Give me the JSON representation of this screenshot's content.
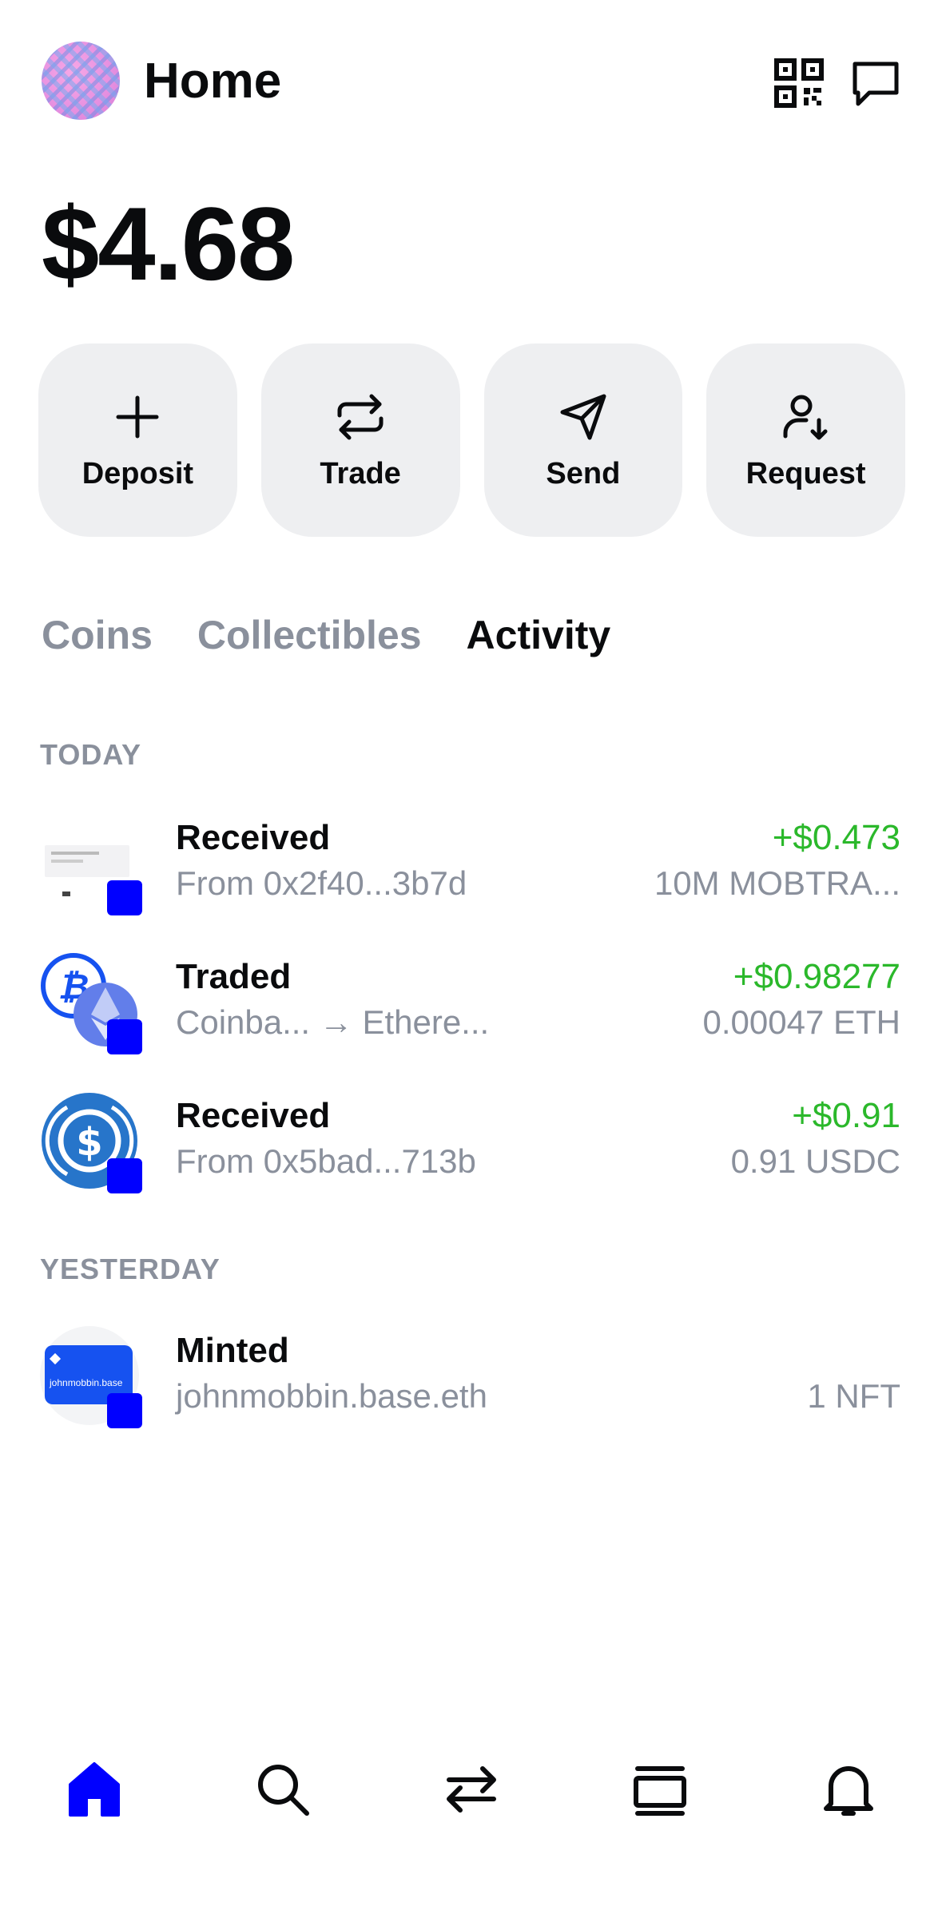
{
  "header": {
    "title": "Home",
    "qr_icon": "qr-code-icon",
    "chat_icon": "chat-bubble-icon"
  },
  "balance": "$4.68",
  "actions": [
    {
      "label": "Deposit",
      "icon": "plus-icon"
    },
    {
      "label": "Trade",
      "icon": "swap-arrows-icon"
    },
    {
      "label": "Send",
      "icon": "paper-plane-icon"
    },
    {
      "label": "Request",
      "icon": "person-download-icon"
    }
  ],
  "tabs": [
    {
      "label": "Coins",
      "active": false
    },
    {
      "label": "Collectibles",
      "active": false
    },
    {
      "label": "Activity",
      "active": true
    }
  ],
  "sections": {
    "today": "TODAY",
    "yesterday": "YESTERDAY"
  },
  "activity": [
    {
      "title": "Received",
      "subtitle": "From 0x2f40...3b7d",
      "amount": "+$0.473",
      "detail": "10M MOBTRA..."
    },
    {
      "title": "Traded",
      "subtitle": "Coinba... → Ethere...",
      "amount": "+$0.98277",
      "detail": "0.00047 ETH"
    },
    {
      "title": "Received",
      "subtitle": "From 0x5bad...713b",
      "amount": "+$0.91",
      "detail": "0.91 USDC"
    },
    {
      "title": "Minted",
      "subtitle": "johnmobbin.base.eth",
      "amount": "",
      "detail": "1 NFT"
    }
  ],
  "nft_card_text": "johnmobbin.base",
  "colors": {
    "accent": "#0000ff",
    "positive": "#2bb82b",
    "muted": "#8a909c",
    "button_bg": "#eeeff1"
  },
  "nav": [
    {
      "icon": "home-icon",
      "active": true
    },
    {
      "icon": "search-icon",
      "active": false
    },
    {
      "icon": "swap-icon",
      "active": false
    },
    {
      "icon": "browser-icon",
      "active": false
    },
    {
      "icon": "bell-icon",
      "active": false
    }
  ]
}
